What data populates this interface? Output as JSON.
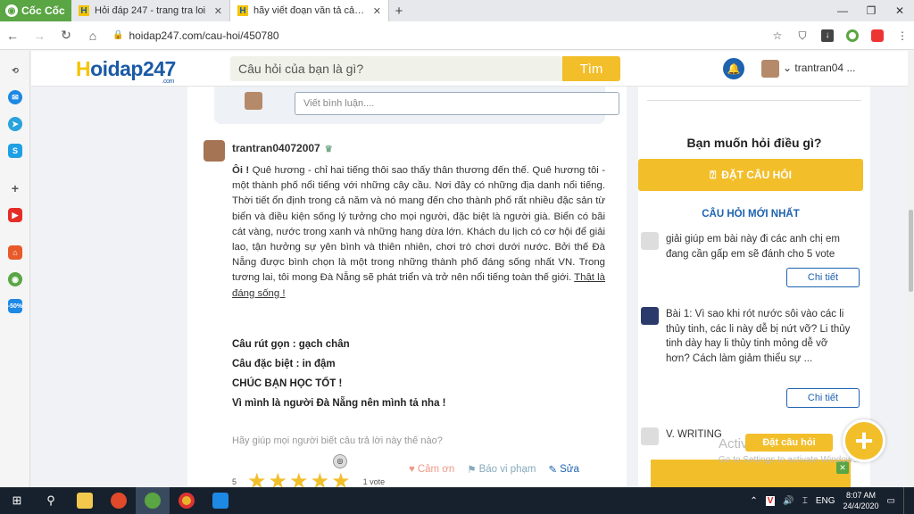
{
  "browser": {
    "brand": "Cốc Cốc",
    "tabs": [
      {
        "title": "Hỏi đáp 247 - trang tra loi",
        "close": "✕"
      },
      {
        "title": "hãy viết đoạn văn tả cảnh quê",
        "close": "✕"
      }
    ],
    "new_tab": "+",
    "url": "hoidap247.com/cau-hoi/450780"
  },
  "site": {
    "logo_main": "oidap247",
    "logo_h": "H",
    "logo_com": ".com",
    "search_placeholder": "Câu hỏi của bạn là gì?",
    "search_button": "Tìm",
    "username": "trantran04 ..."
  },
  "comment": {
    "placeholder": "Viết bình luận...."
  },
  "answer": {
    "author": "trantran04072007",
    "intro_bold": "Ôi !",
    "body": " Quê hương - chỉ hai tiếng thôi sao thấy thân thương đến thế. Quê hương tôi - một thành phố nổi tiếng với những cây cầu. Nơi đây có những địa danh nổi tiếng. Thời tiết ổn định trong cả năm và nó mang đến cho thành phố rất nhiều đặc sản từ biển và điều kiện sống lý tưởng cho mọi người, đặc biệt là người già. Biển có bãi cát vàng, nước trong xanh và những hang dừa lớn. Khách du lịch có cơ hội để giải lao, tận hưởng sự yên bình và thiên nhiên, chơi trò chơi dưới nước. Bởi thế Đà Nẵng được bình chọn là một trong những thành phố đáng sống nhất VN. Trong tương lai, tôi mong Đà Nẵng sẽ phát triển và trở nên nổi tiếng toàn thế giới. ",
    "underlined": "Thật là đáng sống !",
    "notes": [
      "Câu rút gọn : gạch chân",
      "Câu đặc biệt : in đậm",
      "CHÚC BẠN HỌC TỐT !",
      "Vì mình là người Đà Nẵng nên mình tả nha !"
    ],
    "help_text": "Hãy giúp mọi người biết câu trả lời này thế nào?",
    "rating": "5",
    "rating_fraction": 1.0,
    "stars": [
      "★",
      "★",
      "★",
      "★",
      "★"
    ],
    "votes": "1 vote",
    "actions": {
      "thank": "Cảm ơn",
      "report": "Báo vi phạm",
      "edit": "Sửa"
    }
  },
  "right": {
    "ask_title": "Bạn muốn hỏi điều gì?",
    "ask_button": "ĐẶT CÂU HỎI",
    "newest_title": "CÂU HỎI MỚI NHẤT",
    "questions": [
      {
        "text": "giải giúp em bài này đi các anh chị em đang cần gấp em sẽ đánh cho 5 vote",
        "button": "Chi tiết"
      },
      {
        "text": "Bài 1: Vì sao khi rót nước sôi vào các li thủy tinh, các li này dễ bị nứt vỡ? Li thủy tinh dày hay li thủy tinh mỏng dễ vỡ hơn? Cách làm giảm thiểu sự ...",
        "button": "Chi tiết"
      },
      {
        "text": "V. WRITING",
        "button": ""
      }
    ]
  },
  "watermark": {
    "line1": "Activate Windows",
    "line2": "Go to Settings to activate Windows."
  },
  "fab": {
    "label": "Đặt câu hỏi",
    "icon": "+"
  },
  "taskbar": {
    "lang": "ENG",
    "time": "8:07 AM",
    "date": "24/4/2020"
  },
  "colors": {
    "brand_blue": "#1e62b0",
    "brand_yellow": "#f2be2a",
    "coccoc_green": "#5aa544"
  }
}
